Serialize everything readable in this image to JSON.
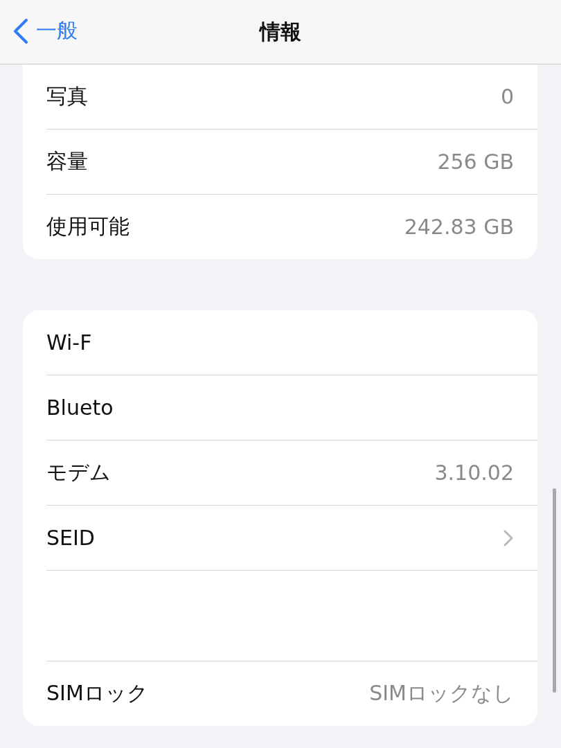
{
  "nav": {
    "back_label": "一般",
    "title": "情報"
  },
  "sections": [
    {
      "rows": [
        {
          "kind": "value",
          "label": "写真",
          "value": "0"
        },
        {
          "kind": "value",
          "label": "容量",
          "value": "256 GB"
        },
        {
          "kind": "value",
          "label": "使用可能",
          "value": "242.83 GB"
        }
      ]
    },
    {
      "rows": [
        {
          "kind": "value",
          "label": "Wi-F"
        },
        {
          "kind": "value",
          "label": "Blueto"
        },
        {
          "kind": "value",
          "label": "モデム",
          "value": "3.10.02"
        },
        {
          "kind": "chevron",
          "label": "SEID"
        },
        {
          "kind": "blank"
        },
        {
          "kind": "value",
          "label": "SIMロック",
          "value": "SIMロックなし"
        }
      ]
    }
  ]
}
